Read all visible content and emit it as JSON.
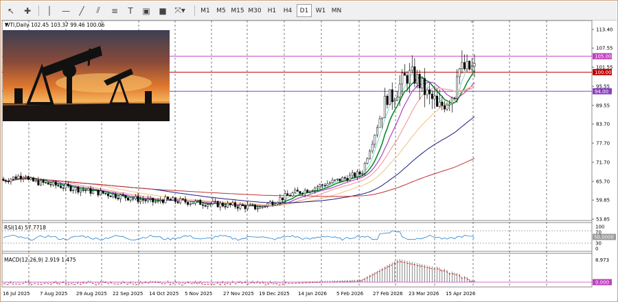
{
  "toolbar": {
    "timeframes": [
      "M1",
      "M5",
      "M15",
      "M30",
      "H1",
      "H4",
      "D1",
      "W1",
      "MN"
    ],
    "active_timeframe": "D1"
  },
  "chart": {
    "title": "WTI,Daily",
    "ohlc": "102.45 103.37 99.46 100.06",
    "price_labels": [
      "113.40",
      "107.55",
      "101.55",
      "95.55",
      "89.55",
      "83.70",
      "77.70",
      "71.70",
      "65.70",
      "59.85",
      "53.85"
    ],
    "level_labels": [
      "105.00",
      "100.00",
      "94.00"
    ],
    "level_colors": [
      "#c040c0",
      "#c00000",
      "#8a40c0"
    ],
    "date_labels": [
      "16 Jul 2025",
      "7 Aug 2025",
      "29 Aug 2025",
      "22 Sep 2025",
      "14 Oct 2025",
      "5 Nov 2025",
      "27 Nov 2025",
      "19 Dec 2025",
      "14 Jan 2026",
      "5 Feb 2026",
      "27 Feb 2026",
      "23 Mar 2026",
      "15 Apr 2026"
    ]
  },
  "rsi": {
    "title": "RSI(14) 57.7718",
    "scale": [
      "100",
      "70",
      "50.0000",
      "30",
      "0"
    ]
  },
  "macd": {
    "title": "MACD(12,26,9) 2.919 1.475",
    "scale": [
      "8.973",
      "0.000"
    ]
  }
}
